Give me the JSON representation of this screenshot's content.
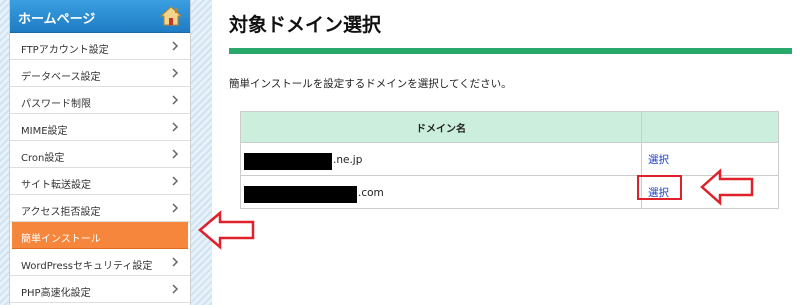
{
  "sidebar": {
    "title": "ホームページ",
    "items": [
      {
        "label": "FTPアカウント設定"
      },
      {
        "label": "データベース設定"
      },
      {
        "label": "パスワード制限"
      },
      {
        "label": "MIME設定"
      },
      {
        "label": "Cron設定"
      },
      {
        "label": "サイト転送設定"
      },
      {
        "label": "アクセス拒否設定"
      },
      {
        "label": "簡単インストール",
        "active": true
      },
      {
        "label": "WordPressセキュリティ設定"
      },
      {
        "label": "PHP高速化設定"
      }
    ]
  },
  "main": {
    "title": "対象ドメイン選択",
    "description": "簡単インストールを設定するドメインを選択してください。",
    "table": {
      "columns": [
        "ドメイン名",
        ""
      ],
      "rows": [
        {
          "domain_suffix": ".ne.jp",
          "action": "選択"
        },
        {
          "domain_suffix": ".com",
          "action": "選択",
          "highlighted": true
        }
      ]
    }
  },
  "colors": {
    "sidebar_header": "#2a8fd6",
    "active_item": "#f6863b",
    "title_rule": "#2aa86b",
    "table_header": "#ccefdd",
    "link": "#1a3ec7",
    "annotation": "#e0202a"
  }
}
